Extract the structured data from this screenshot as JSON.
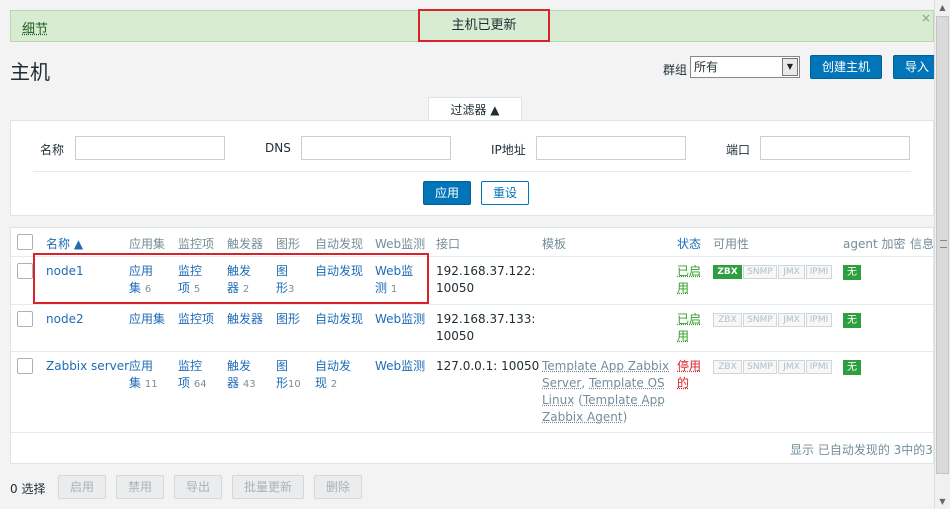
{
  "message": {
    "details": "细节",
    "text": "主机已更新",
    "close": "×"
  },
  "header": {
    "title": "主机",
    "group_label": "群组",
    "group_value": "所有",
    "create_button": "创建主机",
    "import_button": "导入"
  },
  "filter": {
    "tab_label": "过滤器 ▲",
    "name_label": "名称",
    "dns_label": "DNS",
    "ip_label": "IP地址",
    "port_label": "端口",
    "apply": "应用",
    "reset": "重设"
  },
  "table": {
    "columns": {
      "name": "名称 ▲",
      "applications": "应用集",
      "items": "监控项",
      "triggers": "触发器",
      "graphs": "图形",
      "discovery": "自动发现",
      "web": "Web监测",
      "interface": "接口",
      "templates": "模板",
      "status": "状态",
      "availability": "可用性",
      "encryption": "agent 加密",
      "info": "信息"
    },
    "rows": [
      {
        "name": "node1",
        "app_a": "应用",
        "app_b": "集",
        "app_count": "6",
        "items_a": "监控",
        "items_b": "项",
        "items_count": "5",
        "trig_a": "触发",
        "trig_b": "器",
        "trig_count": "2",
        "graph_a": "图",
        "graph_b": "形",
        "graph_count": "3",
        "discovery": "自动发现",
        "web_a": "Web监",
        "web_b": "测",
        "web_count": "1",
        "iface_a": "192.168.37.122:",
        "iface_b": "10050",
        "status_a": "已启",
        "status_b": "用",
        "encryption": "无"
      },
      {
        "name": "node2",
        "apps": "应用集",
        "items": "监控项",
        "triggers": "触发器",
        "graphs": "图形",
        "discovery": "自动发现",
        "web": "Web监测",
        "iface_a": "192.168.37.133:",
        "iface_b": "10050",
        "status_a": "已启",
        "status_b": "用",
        "encryption": "无"
      },
      {
        "name": "Zabbix server",
        "app_a": "应用",
        "app_b": "集",
        "app_count": "11",
        "items_a": "监控",
        "items_b": "项",
        "items_count": "64",
        "trig_a": "触发",
        "trig_b": "器",
        "trig_count": "43",
        "graph_a": "图",
        "graph_b": "形",
        "graph_count": "10",
        "disc_a": "自动发",
        "disc_b": "现",
        "disc_count": "2",
        "web": "Web监测",
        "iface": "127.0.0.1: 10050",
        "tmpl_1": "Template App Zabbix",
        "tmpl_2": "Server",
        "tmpl_3": "Template OS",
        "tmpl_4": "Linux",
        "tmpl_5": "Template App",
        "tmpl_6": "Zabbix Agent",
        "status_a": "停用",
        "status_b": "的",
        "encryption": "无"
      }
    ],
    "availability": {
      "zbx": "ZBX",
      "snmp": "SNMP",
      "jmx": "JMX",
      "ipmi": "IPMI"
    },
    "footer": "显示 已自动发现的 3中的3"
  },
  "mass": {
    "selected": "0 选择",
    "enable": "启用",
    "disable": "禁用",
    "export": "导出",
    "update": "批量更新",
    "delete": "删除"
  },
  "colors": {
    "accent": "#0275b8",
    "success": "#339c28",
    "danger": "#d9232a",
    "msg_bg": "#d7ecd3"
  }
}
